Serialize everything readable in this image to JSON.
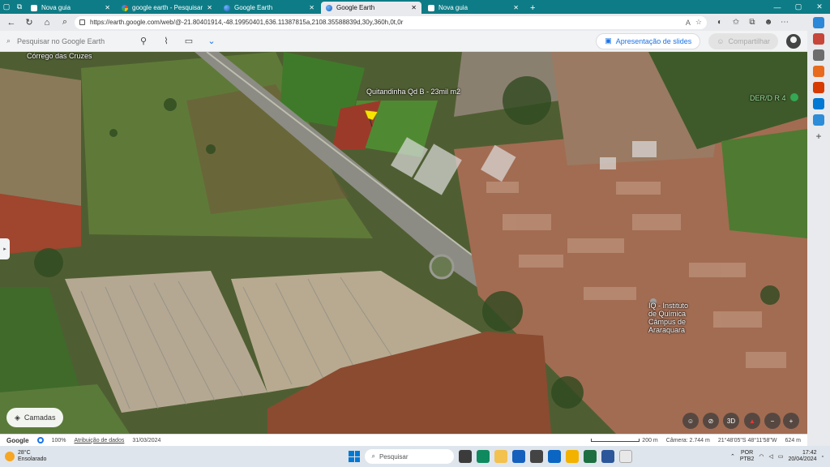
{
  "browser": {
    "tabs": [
      {
        "title": "Nova guia",
        "active": false,
        "favicon": "new-tab"
      },
      {
        "title": "google earth - Pesquisar",
        "active": false,
        "favicon": "bing"
      },
      {
        "title": "Google Earth",
        "active": false,
        "favicon": "earth"
      },
      {
        "title": "Google Earth",
        "active": true,
        "favicon": "earth"
      },
      {
        "title": "Nova guia",
        "active": false,
        "favicon": "new-tab"
      }
    ],
    "new_tab_label": "+",
    "url": "https://earth.google.com/web/@-21.80401914,-48.19950401,636.11387815a,2108.35588839d,30y,360h,0t,0r"
  },
  "earth": {
    "search_placeholder": "Pesquisar no Google Earth",
    "presentation_label": "Apresentação de slides",
    "share_label": "Compartilhar",
    "layers_label": "Camadas",
    "view_3d_label": "3D",
    "map_labels": {
      "corrego": "Córrego das Cruzes",
      "placemark": "Quitandinha Qd B - 23mil m2",
      "der": "DER/D R 4",
      "iq_line1": "IQ - Instituto",
      "iq_line2": "de Química",
      "iq_line3": "Câmpus de",
      "iq_line4": "Araraquara"
    }
  },
  "status": {
    "brand": "Google",
    "zoom": "100%",
    "attribution": "Atribuição de dados",
    "date": "31/03/2024",
    "scale": "200 m",
    "camera": "Câmera: 2.744 m",
    "coords": "21°48'05\"S 48°11'58\"W",
    "elevation": "624 m"
  },
  "taskbar": {
    "temperature": "28°C",
    "condition": "Ensolarado",
    "search_placeholder": "Pesquisar",
    "lang_line1": "POR",
    "lang_line2": "PTB2",
    "time": "17:42",
    "date": "20/04/2024"
  },
  "colors": {
    "tab_bar": "#0e7c86",
    "accent": "#1a73e8"
  }
}
